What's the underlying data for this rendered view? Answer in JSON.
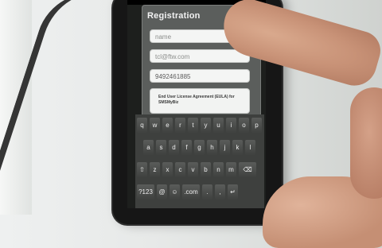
{
  "dialog": {
    "title": "Registration",
    "name_field": {
      "value": "",
      "placeholder": "name"
    },
    "email_field": {
      "value": "tcl@ftw.com"
    },
    "phone_field": {
      "value": "9492461885"
    },
    "eula_text": "End User License Agreement (EULA) for SMSMyBiz"
  },
  "keyboard": {
    "row1": [
      "q",
      "w",
      "e",
      "r",
      "t",
      "y",
      "u",
      "i",
      "o",
      "p"
    ],
    "row2": [
      "a",
      "s",
      "d",
      "f",
      "g",
      "h",
      "j",
      "k",
      "l"
    ],
    "row3": [
      "⇧",
      "z",
      "x",
      "c",
      "v",
      "b",
      "n",
      "m",
      "⌫"
    ],
    "row4": [
      "?123",
      "@",
      "☺",
      ".com",
      ".",
      ",",
      "↵"
    ]
  }
}
